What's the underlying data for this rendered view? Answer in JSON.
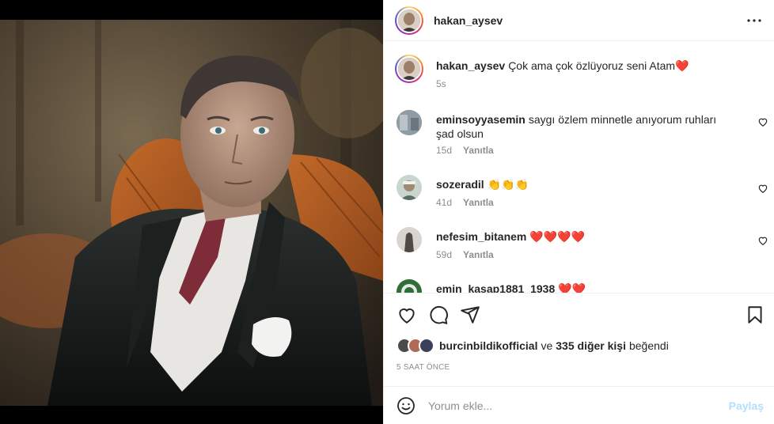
{
  "post": {
    "author": "hakan_aysev",
    "media_alt": ""
  },
  "caption": {
    "username": "hakan_aysev",
    "text": "Çok ama çok özlüyoruz seni Atam❤️",
    "time": "5s"
  },
  "comments": [
    {
      "username": "eminsoyyasemin",
      "text": "saygı özlem minnetle anıyorum ruhları şad olsun",
      "time": "15d",
      "reply": "Yanıtla",
      "avatar_color": "#7d8a93"
    },
    {
      "username": "sozeradil",
      "text": "👏👏👏",
      "time": "41d",
      "reply": "Yanıtla",
      "avatar_color": "#9ab0a6"
    },
    {
      "username": "nefesim_bitanem",
      "text": "❤️❤️❤️❤️",
      "time": "59d",
      "reply": "Yanıtla",
      "avatar_color": "#6f6a66"
    },
    {
      "username": "emin_kasap1881_1938",
      "text": "❤️❤️",
      "time": "",
      "reply": "",
      "avatar_color": "#3a7a3d"
    }
  ],
  "likes": {
    "first_user": "burcinbildikofficial",
    "connector": "ve",
    "others": "335 diğer kişi",
    "suffix": "beğendi",
    "avatar_colors": [
      "#4a4a4a",
      "#b06a55",
      "#3b3f5a"
    ]
  },
  "time_ago": "5 SAAT ÖNCE",
  "comment_box": {
    "placeholder": "Yorum ekle...",
    "share_label": "Paylaş"
  },
  "colors": {
    "accent_disabled": "#b2dffc",
    "muted": "#8e8e8e",
    "border": "#efefef"
  }
}
